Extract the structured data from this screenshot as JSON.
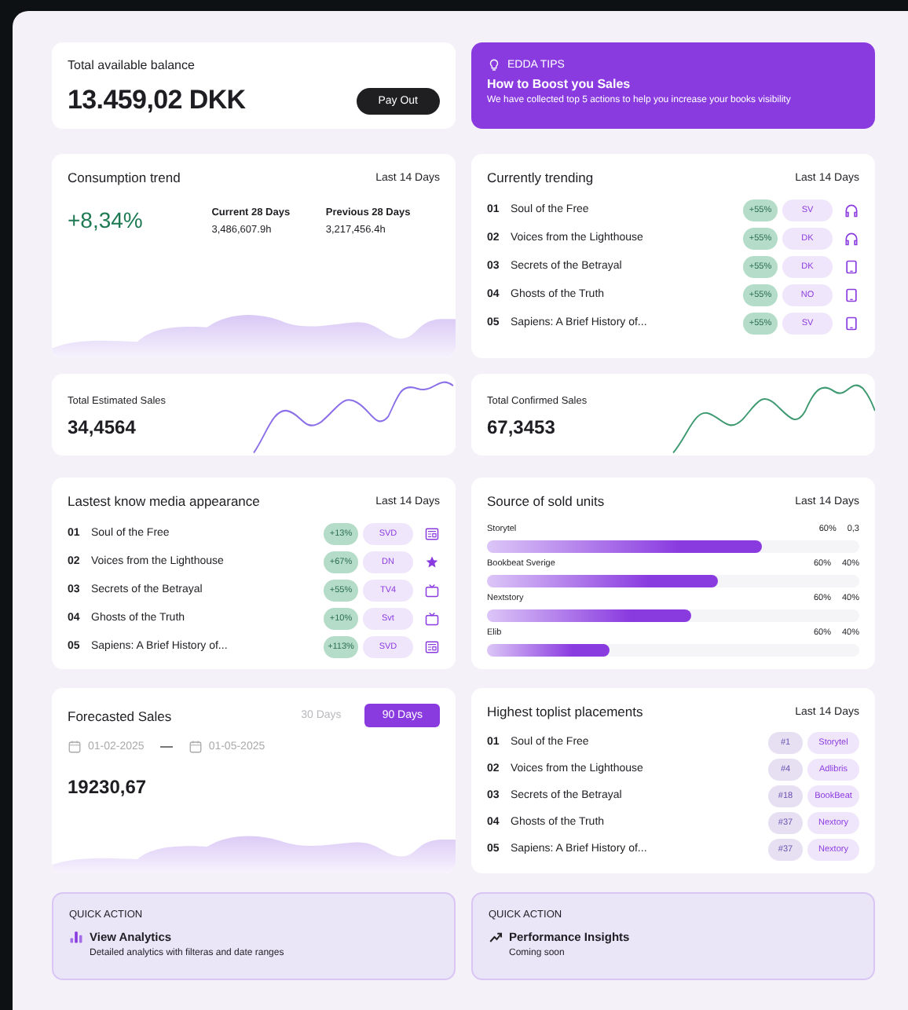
{
  "balance": {
    "label": "Total available balance",
    "amount": "13.459,02 DKK",
    "button": "Pay Out"
  },
  "tips": {
    "tag": "EDDA TIPS",
    "title": "How to Boost you Sales",
    "text": "We have collected top 5 actions to help you increase your books visibility"
  },
  "consumption": {
    "title": "Consumption trend",
    "period": "Last 14 Days",
    "change": "+8,34%",
    "current": {
      "label": "Current 28 Days",
      "value": "3,486,607.9h"
    },
    "previous": {
      "label": "Previous 28 Days",
      "value": "3,217,456.4h"
    }
  },
  "trending": {
    "title": "Currently trending",
    "period": "Last 14 Days",
    "items": [
      {
        "rank": "01",
        "title": "Soul of the Free",
        "change": "+55%",
        "tag": "SV",
        "kind": "headphones"
      },
      {
        "rank": "02",
        "title": "Voices from the Lighthouse",
        "change": "+55%",
        "tag": "DK",
        "kind": "headphones"
      },
      {
        "rank": "03",
        "title": "Secrets of the Betrayal",
        "change": "+55%",
        "tag": "DK",
        "kind": "tablet"
      },
      {
        "rank": "04",
        "title": "Ghosts of the Truth",
        "change": "+55%",
        "tag": "NO",
        "kind": "tablet"
      },
      {
        "rank": "05",
        "title": "Sapiens: A Brief History of...",
        "change": "+55%",
        "tag": "SV",
        "kind": "tablet"
      }
    ]
  },
  "sales_cards": [
    {
      "label": "Total Estimated Sales",
      "value": "34,4564",
      "color": "#8b6fe8"
    },
    {
      "label": "Total Confirmed Sales",
      "value": "67,3453",
      "color": "#3f9a72"
    }
  ],
  "media": {
    "title": "Lastest know media appearance",
    "period": "Last 14 Days",
    "items": [
      {
        "rank": "01",
        "title": "Soul of the Free",
        "change": "+13%",
        "tag": "SVD",
        "kind": "newspaper"
      },
      {
        "rank": "02",
        "title": "Voices from the Lighthouse",
        "change": "+67%",
        "tag": "DN",
        "kind": "star"
      },
      {
        "rank": "03",
        "title": "Secrets of the Betrayal",
        "change": "+55%",
        "tag": "TV4",
        "kind": "tv"
      },
      {
        "rank": "04",
        "title": "Ghosts of the Truth",
        "change": "+10%",
        "tag": "Svt",
        "kind": "tv"
      },
      {
        "rank": "05",
        "title": "Sapiens: A Brief History of...",
        "change": "+113%",
        "tag": "SVD",
        "kind": "newspaper"
      }
    ]
  },
  "sources": {
    "title": "Source of sold units",
    "period": "Last 14 Days",
    "items": [
      {
        "name": "Storytel",
        "share": "60%",
        "reading": "0,3",
        "level": 0.74
      },
      {
        "name": "Bookbeat Sverige",
        "share": "60%",
        "reading": "40%",
        "level": 0.62
      },
      {
        "name": "Nextstory",
        "share": "60%",
        "reading": "40%",
        "level": 0.55
      },
      {
        "name": "Elib",
        "share": "60%",
        "reading": "40%",
        "level": 0.33
      }
    ]
  },
  "forecast": {
    "title": "Forecasted Sales",
    "ranges": [
      {
        "label": "30 Days",
        "selected": false
      },
      {
        "label": "90 Days",
        "selected": true
      }
    ],
    "from": "01-02-2025",
    "to": "01-05-2025",
    "value": "19230,67"
  },
  "toplist": {
    "title": "Highest toplist placements",
    "period": "Last 14 Days",
    "items": [
      {
        "rank": "01",
        "title": "Soul of the Free",
        "position": "#1",
        "store": "Storytel"
      },
      {
        "rank": "02",
        "title": "Voices from the Lighthouse",
        "position": "#4",
        "store": "Adlibris"
      },
      {
        "rank": "03",
        "title": "Secrets of the Betrayal",
        "position": "#18",
        "store": "BookBeat"
      },
      {
        "rank": "04",
        "title": "Ghosts of the Truth",
        "position": "#37",
        "store": "Nextory"
      },
      {
        "rank": "05",
        "title": "Sapiens: A Brief History of...",
        "position": "#37",
        "store": "Nextory"
      }
    ]
  },
  "quick_actions": [
    {
      "tag": "QUICK ACTION",
      "title": "View Analytics",
      "text": "Detailed analytics with filteras and date ranges",
      "kind": "chart"
    },
    {
      "tag": "QUICK ACTION",
      "title": "Performance Insights",
      "text": "Coming soon",
      "kind": "trend"
    }
  ]
}
